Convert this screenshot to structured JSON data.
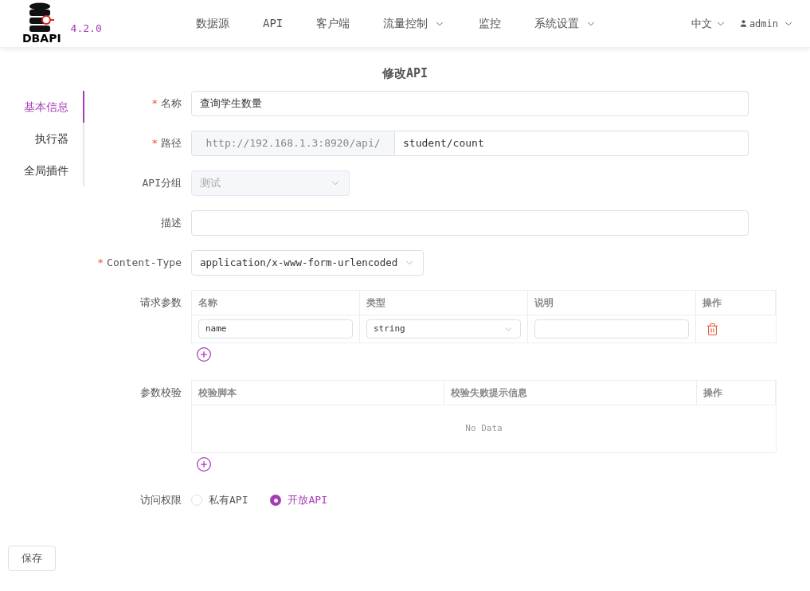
{
  "header": {
    "logo_text": "DBAPI",
    "version": "4.2.0",
    "nav": [
      {
        "label": "数据源",
        "dropdown": false
      },
      {
        "label": "API",
        "dropdown": false
      },
      {
        "label": "客户端",
        "dropdown": false
      },
      {
        "label": "流量控制",
        "dropdown": true
      },
      {
        "label": "监控",
        "dropdown": false
      },
      {
        "label": "系统设置",
        "dropdown": true
      }
    ],
    "language": {
      "label": "中文"
    },
    "user": {
      "label": "admin"
    }
  },
  "title": "修改API",
  "side_tabs": [
    {
      "label": "基本信息",
      "selected": true
    },
    {
      "label": "执行器",
      "selected": false
    },
    {
      "label": "全局插件",
      "selected": false
    }
  ],
  "form": {
    "name": {
      "required_mark": "*",
      "label": "名称",
      "value": "查询学生数量"
    },
    "path": {
      "required_mark": "*",
      "label": "路径",
      "prefix": "http://192.168.1.3:8920/api/",
      "value": "student/count"
    },
    "group": {
      "label": "API分组",
      "value": "测试",
      "disabled": true
    },
    "description": {
      "label": "描述"
    },
    "content_type": {
      "required_mark": "*",
      "label": "Content-Type",
      "value": "application/x-www-form-urlencoded"
    },
    "params": {
      "label": "请求参数",
      "columns": [
        "名称",
        "类型",
        "说明",
        "操作"
      ],
      "rows": [
        {
          "name": "name",
          "type": "string"
        }
      ]
    },
    "validation": {
      "label": "参数校验",
      "columns": [
        "校验脚本",
        "校验失败提示信息",
        "操作"
      ],
      "empty_text": "No Data"
    },
    "access": {
      "label": "访问权限",
      "options": [
        {
          "label": "私有API",
          "selected": false
        },
        {
          "label": "开放API",
          "selected": true
        }
      ]
    }
  },
  "save_button": "保存"
}
